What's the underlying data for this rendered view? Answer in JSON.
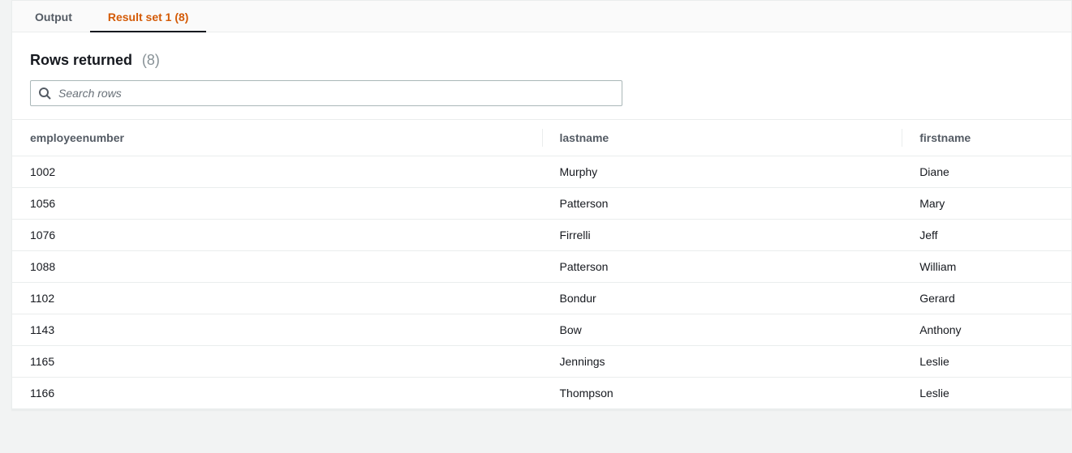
{
  "tabs": {
    "output": "Output",
    "resultset": "Result set 1 (8)"
  },
  "header": {
    "title": "Rows returned",
    "count": "(8)"
  },
  "search": {
    "placeholder": "Search rows"
  },
  "table": {
    "columns": {
      "employeenumber": "employeenumber",
      "lastname": "lastname",
      "firstname": "firstname"
    },
    "rows": [
      {
        "employeenumber": "1002",
        "lastname": "Murphy",
        "firstname": "Diane"
      },
      {
        "employeenumber": "1056",
        "lastname": "Patterson",
        "firstname": "Mary"
      },
      {
        "employeenumber": "1076",
        "lastname": "Firrelli",
        "firstname": "Jeff"
      },
      {
        "employeenumber": "1088",
        "lastname": "Patterson",
        "firstname": "William"
      },
      {
        "employeenumber": "1102",
        "lastname": "Bondur",
        "firstname": "Gerard"
      },
      {
        "employeenumber": "1143",
        "lastname": "Bow",
        "firstname": "Anthony"
      },
      {
        "employeenumber": "1165",
        "lastname": "Jennings",
        "firstname": "Leslie"
      },
      {
        "employeenumber": "1166",
        "lastname": "Thompson",
        "firstname": "Leslie"
      }
    ]
  }
}
